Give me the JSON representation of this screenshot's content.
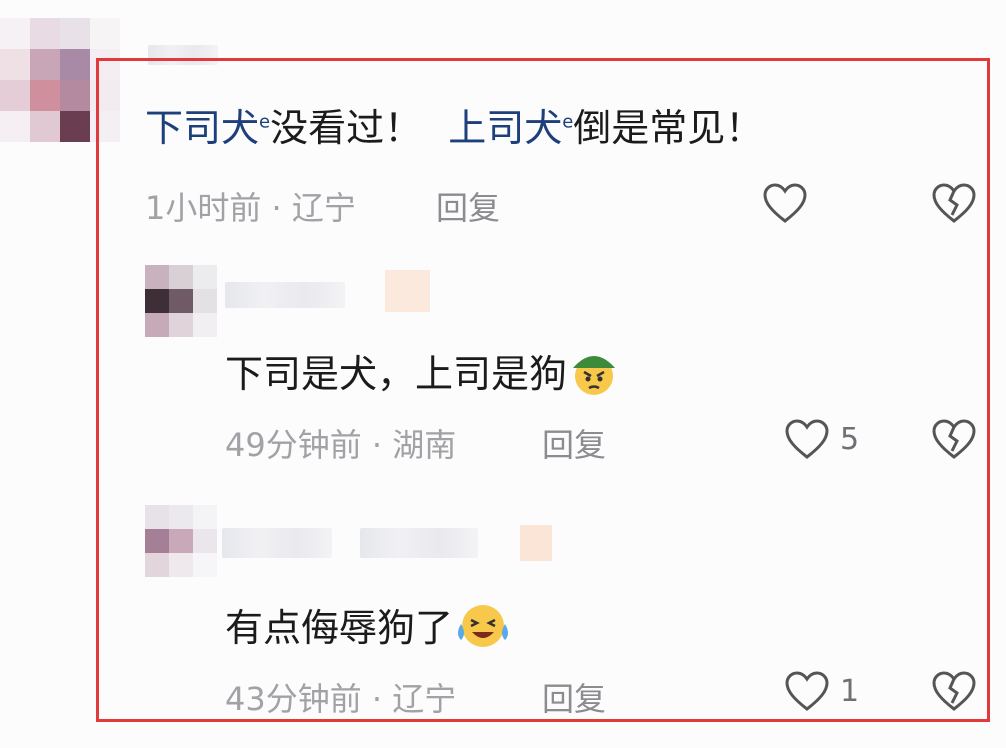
{
  "comment": {
    "mention_1": "下司犬",
    "text_1": "没看过！",
    "mention_2": "上司犬",
    "text_2": "倒是常见！",
    "time": "1小时前",
    "separator": "·",
    "location": "辽宁",
    "reply_label": "回复"
  },
  "replies": [
    {
      "text": "下司是犬，上司是狗",
      "emoji": "angry-leaf-face-emoji",
      "time": "49分钟前",
      "separator": "·",
      "location": "湖南",
      "reply_label": "回复",
      "likes": "5"
    },
    {
      "text": "有点侮辱狗了",
      "emoji": "crying-laughing-face-emoji",
      "time": "43分钟前",
      "separator": "·",
      "location": "辽宁",
      "reply_label": "回复",
      "likes": "1"
    }
  ],
  "icons": {
    "like": "heart-outline-icon",
    "dislike": "broken-heart-icon",
    "mention_search": "search-icon"
  },
  "colors": {
    "highlight_frame": "#e03a3a",
    "mention": "#1d3f7c",
    "meta": "#a2a2a6"
  }
}
